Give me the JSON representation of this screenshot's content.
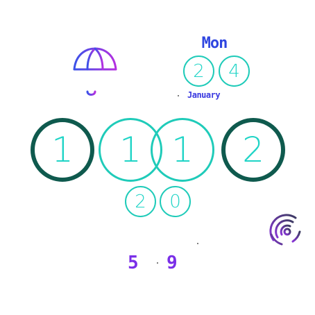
{
  "weather": {
    "icon": "umbrella-icon"
  },
  "date": {
    "weekday": "Mon",
    "day_digits": [
      "2",
      "4"
    ],
    "month": "January"
  },
  "time": {
    "hour_digits": [
      "1",
      "1"
    ],
    "minute_digits": [
      "1",
      "2"
    ],
    "second_digits": [
      "2",
      "0"
    ]
  },
  "status": {
    "connectivity_icon": "wifi-icon",
    "steps_digits": [
      "5",
      "9"
    ]
  },
  "colors": {
    "ring_dark": "#0f5a4e",
    "ring_light": "#1fcbb9",
    "digit": "#1fd4c6",
    "accent_blue": "#2f46e0",
    "accent_purple": "#7a2fe8"
  }
}
